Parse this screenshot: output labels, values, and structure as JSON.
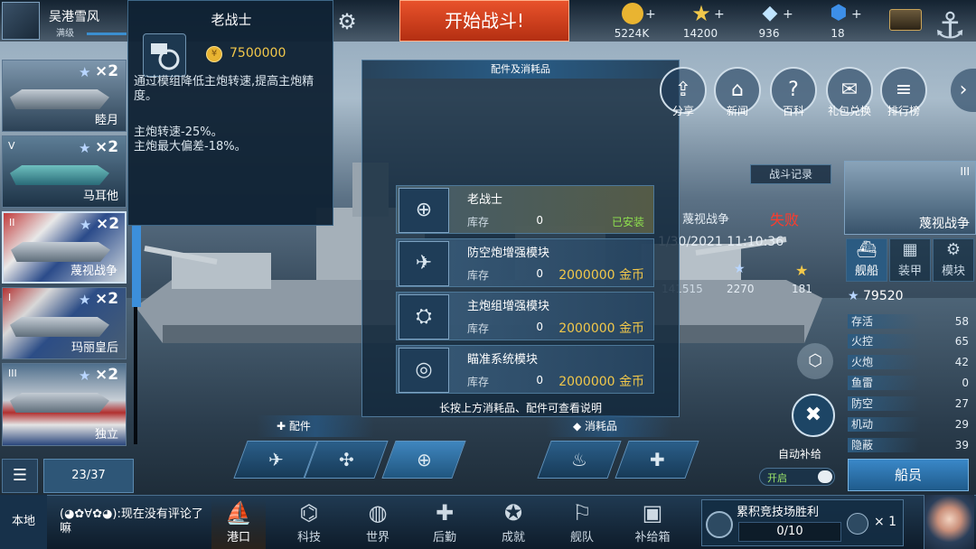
{
  "player": {
    "name": "吴港雪风",
    "level": "满级"
  },
  "top": {
    "start_battle": "开始战斗!",
    "resources": [
      {
        "icon": "gold-coin-icon",
        "value": "5224K",
        "color": "#e9b431"
      },
      {
        "icon": "gold-star-icon",
        "value": "14200",
        "color": "#f2c84a"
      },
      {
        "icon": "diamond-icon",
        "value": "936",
        "color": "#bfe4ff"
      },
      {
        "icon": "blue-gem-icon",
        "value": "18",
        "color": "#3d8fe8"
      }
    ]
  },
  "fleet": {
    "ships": [
      {
        "tier": "",
        "count": "×2",
        "name": "睦月"
      },
      {
        "tier": "V",
        "count": "×2",
        "name": "马耳他"
      },
      {
        "tier": "II",
        "count": "×2",
        "name": "蔑视战争"
      },
      {
        "tier": "I",
        "count": "×2",
        "name": "玛丽皇后"
      },
      {
        "tier": "III",
        "count": "×2",
        "name": "独立"
      }
    ],
    "page": "23/37"
  },
  "tooltip": {
    "title": "老战士",
    "price": "7500000",
    "coin_glyph": "¥",
    "desc": "通过模组降低主炮转速,提高主炮精度。",
    "stat1": "主炮转速-25%。",
    "stat2": "主炮最大偏差-18%。"
  },
  "panel": {
    "title": "配件及消耗品",
    "stock_label": "库存",
    "items": [
      {
        "name": "老战士",
        "stock": "0",
        "status": "已安装"
      },
      {
        "name": "防空炮增强模块",
        "stock": "0",
        "price": "2000000 金币"
      },
      {
        "name": "主炮组增强模块",
        "stock": "0",
        "price": "2000000 金币"
      },
      {
        "name": "瞄准系统模块",
        "stock": "0",
        "price": "2000000 金币"
      }
    ],
    "hint": "长按上方消耗品、配件可查看说明"
  },
  "bottom_sections": {
    "parts": "配件",
    "consumables": "消耗品"
  },
  "battle_record": {
    "button": "战斗记录",
    "ship": "蔑视战争",
    "result": "失败",
    "datetime": "1/30/2021 11:10:36",
    "gold": "141515",
    "stars": "2270",
    "points": "181"
  },
  "right_nav": [
    {
      "icon": "share-icon",
      "label": "分享"
    },
    {
      "icon": "news-icon",
      "label": "新闻"
    },
    {
      "icon": "encyclopedia-icon",
      "label": "百科"
    },
    {
      "icon": "gift-icon",
      "label": "礼包兑换"
    },
    {
      "icon": "ranking-icon",
      "label": "排行榜"
    }
  ],
  "right_panel": {
    "ship_name": "蔑视战争",
    "tier": "III",
    "tabs": [
      "舰船",
      "装甲",
      "模块"
    ],
    "power": "79520",
    "stats": [
      {
        "label": "存活",
        "value": "58"
      },
      {
        "label": "火控",
        "value": "65"
      },
      {
        "label": "火炮",
        "value": "42"
      },
      {
        "label": "鱼雷",
        "value": "0"
      },
      {
        "label": "防空",
        "value": "27"
      },
      {
        "label": "机动",
        "value": "29"
      },
      {
        "label": "隐蔽",
        "value": "39"
      }
    ],
    "auto_supply": "自动补给",
    "toggle_on": "开启",
    "crew": "船员"
  },
  "bottom_bar": {
    "local": "本地",
    "chat": "(◕✿∀✿◕):现在没有评论了嘛",
    "nav": [
      "港口",
      "科技",
      "世界",
      "后勤",
      "成就",
      "舰队",
      "补给箱"
    ],
    "quest_title": "累积竞技场胜利",
    "quest_progress": "0/10",
    "quest_reward": "× 1"
  },
  "colors": {
    "accent": "#3c8fdb",
    "start": "#e8522b",
    "installed": "#8ee04e",
    "price": "#f2c84a",
    "defeat": "#ff3b2b"
  }
}
